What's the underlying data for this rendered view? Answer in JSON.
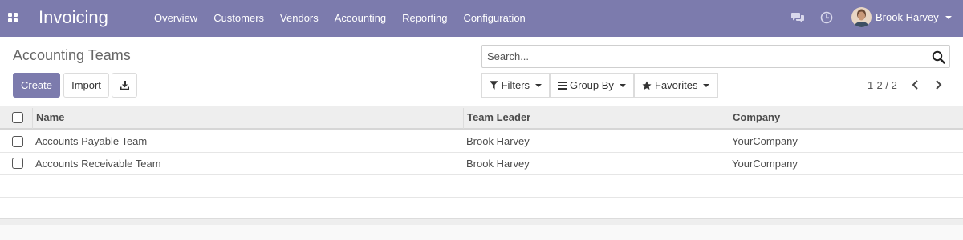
{
  "navbar": {
    "app_title": "Invoicing",
    "menu": [
      "Overview",
      "Customers",
      "Vendors",
      "Accounting",
      "Reporting",
      "Configuration"
    ],
    "user_name": "Brook Harvey",
    "icons": [
      "apps-icon",
      "chat-icon",
      "clock-icon"
    ]
  },
  "control_panel": {
    "title": "Accounting Teams",
    "create_label": "Create",
    "import_label": "Import",
    "search_placeholder": "Search...",
    "filters_label": "Filters",
    "group_by_label": "Group By",
    "favorites_label": "Favorites",
    "pager": "1-2 / 2"
  },
  "table": {
    "columns": [
      "Name",
      "Team Leader",
      "Company"
    ],
    "rows": [
      [
        "Accounts Payable Team",
        "Brook Harvey",
        "YourCompany"
      ],
      [
        "Accounts Receivable Team",
        "Brook Harvey",
        "YourCompany"
      ]
    ]
  },
  "colors": {
    "brand": "#7c7bad",
    "header_bg": "#eeeeee"
  }
}
